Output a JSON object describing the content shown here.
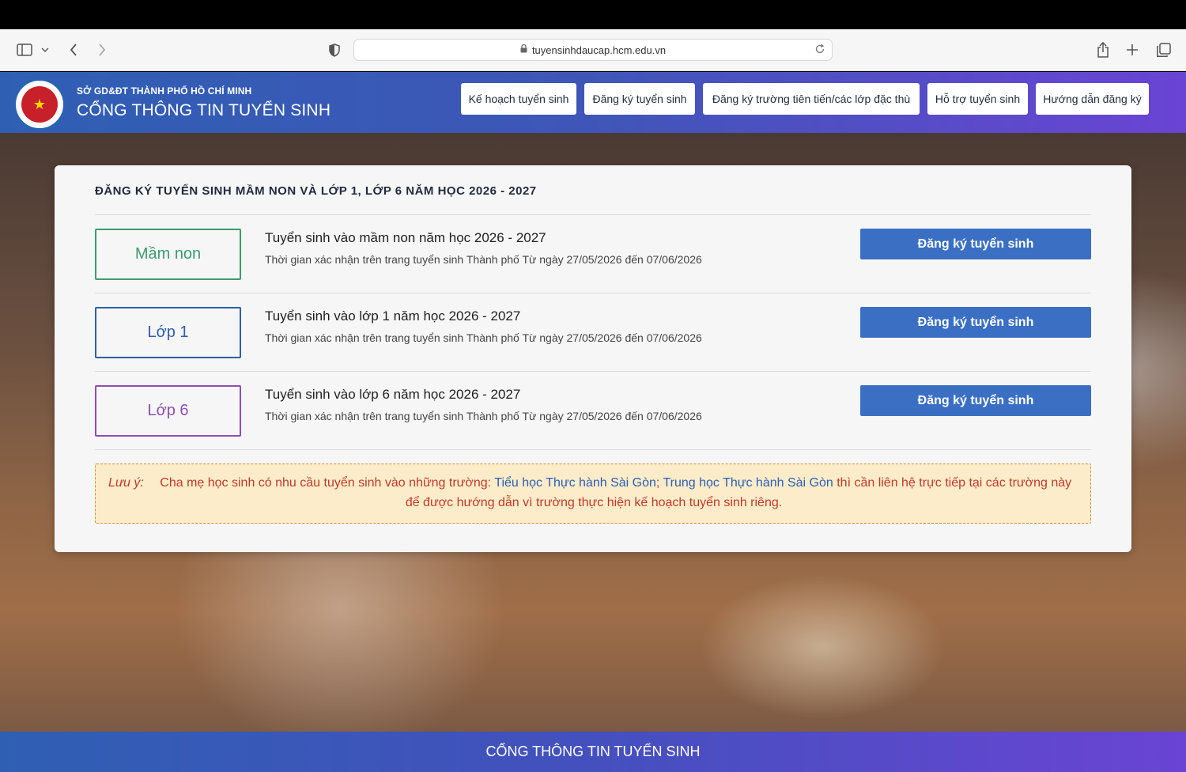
{
  "browser": {
    "url": "tuyensinhdaucap.hcm.edu.vn"
  },
  "header": {
    "subtitle": "SỞ GD&ĐT THÀNH PHỐ HỒ CHÍ MINH",
    "title": "CỔNG THÔNG TIN TUYỂN SINH",
    "nav": [
      {
        "label": "Kế hoạch tuyển sinh"
      },
      {
        "label": "Đăng ký tuyển sinh"
      },
      {
        "label": "Đăng ký trường tiên tiến/các lớp đặc thù"
      },
      {
        "label": "Hỗ trợ tuyển sinh"
      },
      {
        "label": "Hướng dẫn đăng ký"
      }
    ]
  },
  "card": {
    "title": "ĐĂNG KÝ TUYỂN SINH MẦM NON VÀ LỚP 1, LỚP 6 NĂM HỌC 2026 - 2027",
    "rows": [
      {
        "level": "Mầm non",
        "title": "Tuyển sinh vào mầm non năm học 2026 - 2027",
        "desc": "Thời gian xác nhận trên trang tuyển sinh Thành phố Từ ngày 27/05/2026 đến 07/06/2026",
        "button": "Đăng ký tuyển sinh",
        "color": "#3f9a6e"
      },
      {
        "level": "Lớp 1",
        "title": "Tuyển sinh vào lớp 1 năm học 2026 - 2027",
        "desc": "Thời gian xác nhận trên trang tuyển sinh Thành phố Từ ngày 27/05/2026 đến 07/06/2026",
        "button": "Đăng ký tuyển sinh",
        "color": "#2f5ea8"
      },
      {
        "level": "Lớp 6",
        "title": "Tuyển sinh vào lớp 6 năm học 2026 - 2027",
        "desc": "Thời gian xác nhận trên trang tuyển sinh Thành phố Từ ngày 27/05/2026 đến 07/06/2026",
        "button": "Đăng ký tuyển sinh",
        "color": "#8e4fb0"
      }
    ],
    "note": {
      "label": "Lưu ý:",
      "text1": "Cha mẹ học sinh có nhu cầu tuyển sinh vào những trường:",
      "link1": "Tiểu học Thực hành Sài Gòn",
      "sep": ";",
      "link2": "Trung học Thực hành Sài Gòn",
      "text2": "thì cần liên hệ trực tiếp tại các trường này",
      "text3": "để được hướng dẫn vì trường thực hiện kế hoạch tuyển sinh riêng."
    }
  },
  "footer": {
    "title": "CỔNG THÔNG TIN TUYỂN SINH"
  }
}
